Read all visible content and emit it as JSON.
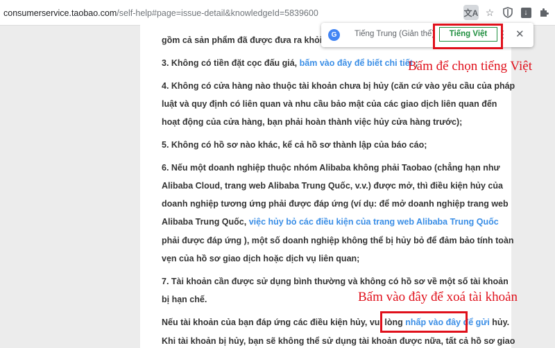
{
  "browser": {
    "url_domain": "consumerservice.taobao.com",
    "url_path": "/self-help#page=issue-detail&knowledgeId=5839600",
    "toolbar_icons": [
      "translate-icon",
      "star-icon",
      "shield-icon",
      "download-icon",
      "puzzle-icon"
    ]
  },
  "translate_popup": {
    "lang_source": "Tiếng Trung (Giản thể)",
    "lang_target": "Tiếng Việt",
    "menu": "⋮",
    "close": "✕"
  },
  "article": {
    "line1": "gồm cả sản phẩm đã được đưa ra khỏi kệ",
    "item3_text": "3. Không có tiền đặt cọc đấu giá, ",
    "item3_link": "bấm vào đây để biết chi tiết",
    "item3_end": " ;",
    "item4_l1": "4. Không có cửa hàng nào thuộc tài khoản chưa bị hủy (căn cứ vào yêu cầu của pháp",
    "item4_l2": "luật và quy định có liên quan và nhu cầu bảo mật của các giao dịch liên quan đến",
    "item4_l3": "hoạt động của cửa hàng, bạn phải hoàn thành việc hủy cửa hàng trước);",
    "item5": "5. Không có hồ sơ nào khác, kể cả hồ sơ thành lập của báo cáo;",
    "item6_l1": "6. Nếu một doanh nghiệp thuộc nhóm Alibaba không phải Taobao (chẳng hạn như",
    "item6_l2": "Alibaba Cloud, trang web Alibaba Trung Quốc, v.v.) được mở, thì điều kiện hủy của",
    "item6_l3": "doanh nghiệp tương ứng phải được đáp ứng (ví dụ: để mở doanh nghiệp trang web",
    "item6_l4_text": "Alibaba Trung Quốc, ",
    "item6_l4_link": "việc hủy bỏ các điều kiện của trang web Alibaba Trung Quốc",
    "item6_l5": "phải được đáp ứng ), một số doanh nghiệp không thể bị hủy bỏ để đảm bảo tính toàn",
    "item6_l6": "vẹn của hồ sơ giao dịch hoặc dịch vụ liên quan;",
    "item7_l1": "7. Tài khoản cần được sử dụng bình thường và không có hồ sơ về một số tài khoản",
    "item7_l2": "bị hạn chế.",
    "final_text": "Nếu tài khoản của bạn đáp ứng các điều kiện hủy, vui lòng ",
    "final_link": "nhấp vào đây để gửi",
    "final_end": " hủy.",
    "last_line": "Khi tài khoản bị hủy, bạn sẽ không thể sử dụng tài khoản được nữa, tất cả hồ sơ giao"
  },
  "annotations": {
    "choose_vietnamese": "Bấm để chọn tiếng Việt",
    "delete_account": "Bấm vào đây để xoá tài khoản",
    "color": "#e0101b"
  }
}
